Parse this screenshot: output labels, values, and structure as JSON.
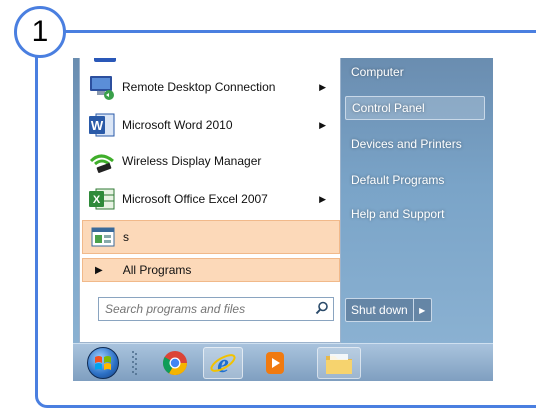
{
  "step_number": "1",
  "programs": [
    {
      "label": "Remote Desktop Connection",
      "icon": "remote-desktop-icon",
      "has_submenu": true
    },
    {
      "label": "Microsoft Word 2010",
      "icon": "word-icon",
      "has_submenu": true
    },
    {
      "label": "Wireless Display Manager",
      "icon": "wireless-display-icon",
      "has_submenu": false
    },
    {
      "label": "Microsoft Office Excel 2007",
      "icon": "excel-icon",
      "has_submenu": true
    },
    {
      "label": "s",
      "icon": "app-window-icon",
      "has_submenu": false,
      "highlighted": true
    }
  ],
  "all_programs_label": "All Programs",
  "search": {
    "placeholder": "Search programs and files",
    "value": ""
  },
  "right_items": [
    {
      "label": "Computer"
    },
    {
      "label": "Control Panel",
      "highlighted": true
    },
    {
      "label": "Devices and Printers"
    },
    {
      "label": "Default Programs"
    },
    {
      "label": "Help and Support"
    }
  ],
  "shutdown_label": "Shut down",
  "taskbar": {
    "items": [
      "start-orb-icon",
      "chrome-icon",
      "internet-explorer-icon",
      "media-player-icon",
      "file-explorer-icon"
    ]
  },
  "colors": {
    "accent": "#4a7fe0",
    "highlight": "#fcd9b9"
  }
}
